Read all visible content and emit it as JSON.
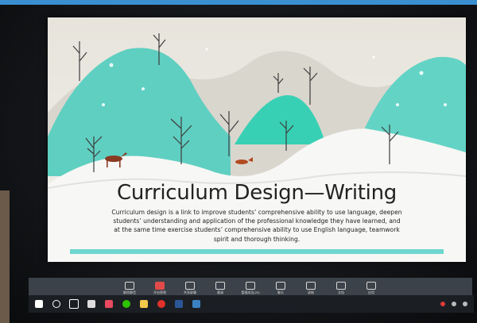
{
  "slide": {
    "title": "Curriculum Design—Writing",
    "body": "Curriculum design is a link to improve students’ comprehensive ability to use language, deepen students’ understanding and application of the professional knowledge they have learned, and at the same time exercise students’ comprehensive ability to use English language, teamwork spirit and thorough thinking.",
    "accent_color": "#6dd6cf"
  },
  "meeting_toolbar": {
    "items": [
      {
        "icon": "microphone-icon",
        "label": "解除静音"
      },
      {
        "icon": "camera-off-icon",
        "label": "开启视频"
      },
      {
        "icon": "share-screen-icon",
        "label": "共享屏幕"
      },
      {
        "icon": "invite-icon",
        "label": "邀请"
      },
      {
        "icon": "participants-icon",
        "label": "管理成员(29)"
      },
      {
        "icon": "chat-icon",
        "label": "聊天"
      },
      {
        "icon": "record-icon",
        "label": "录制"
      },
      {
        "icon": "document-icon",
        "label": "文档"
      },
      {
        "icon": "apps-icon",
        "label": "应用"
      }
    ]
  },
  "taskbar": {
    "items": [
      {
        "name": "windows-start-icon",
        "color": "#ffffff"
      },
      {
        "name": "search-icon",
        "color": "#ffffff"
      },
      {
        "name": "task-view-icon",
        "color": "#ffffff"
      },
      {
        "name": "app-icon",
        "color": "#dddddd"
      },
      {
        "name": "app-icon",
        "color": "#e84a5f"
      },
      {
        "name": "wechat-icon",
        "color": "#2dc100"
      },
      {
        "name": "file-explorer-icon",
        "color": "#f2c84b"
      },
      {
        "name": "app-icon",
        "color": "#e0322b"
      },
      {
        "name": "word-icon",
        "color": "#2b5797"
      },
      {
        "name": "app-icon",
        "color": "#3b82c4"
      }
    ]
  }
}
